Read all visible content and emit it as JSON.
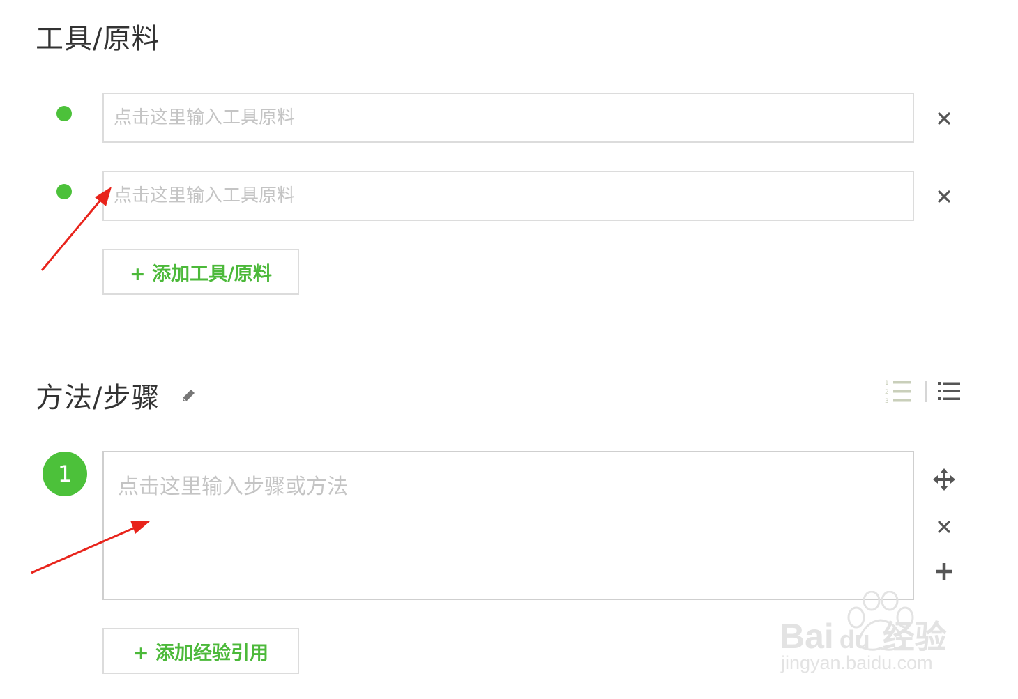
{
  "materials": {
    "title": "工具/原料",
    "items": [
      {
        "placeholder": "点击这里输入工具原料",
        "value": ""
      },
      {
        "placeholder": "点击这里输入工具原料",
        "value": ""
      }
    ],
    "add_label": "+ 添加工具/原料"
  },
  "steps": {
    "title": "方法/步骤",
    "items": [
      {
        "number": "1",
        "placeholder": "点击这里输入步骤或方法",
        "value": ""
      }
    ],
    "add_reference_label": "+ 添加经验引用"
  },
  "watermark": {
    "brand_latin": "Bai",
    "brand_du": "du",
    "brand_cn": "经验",
    "url": "jingyan.baidu.com"
  },
  "icons": {
    "remove": "close-icon",
    "move": "move-arrows-icon",
    "add_step": "plus-icon",
    "edit": "pencil-icon",
    "numbered_list": "numbered-list-icon",
    "bullet_list": "bullet-list-icon",
    "bullet": "green-dot-bullet"
  },
  "colors": {
    "accent": "#4cc13a",
    "annotation_arrow": "#e8231b",
    "border": "#dcdcdc",
    "placeholder": "#c4c4c4"
  }
}
